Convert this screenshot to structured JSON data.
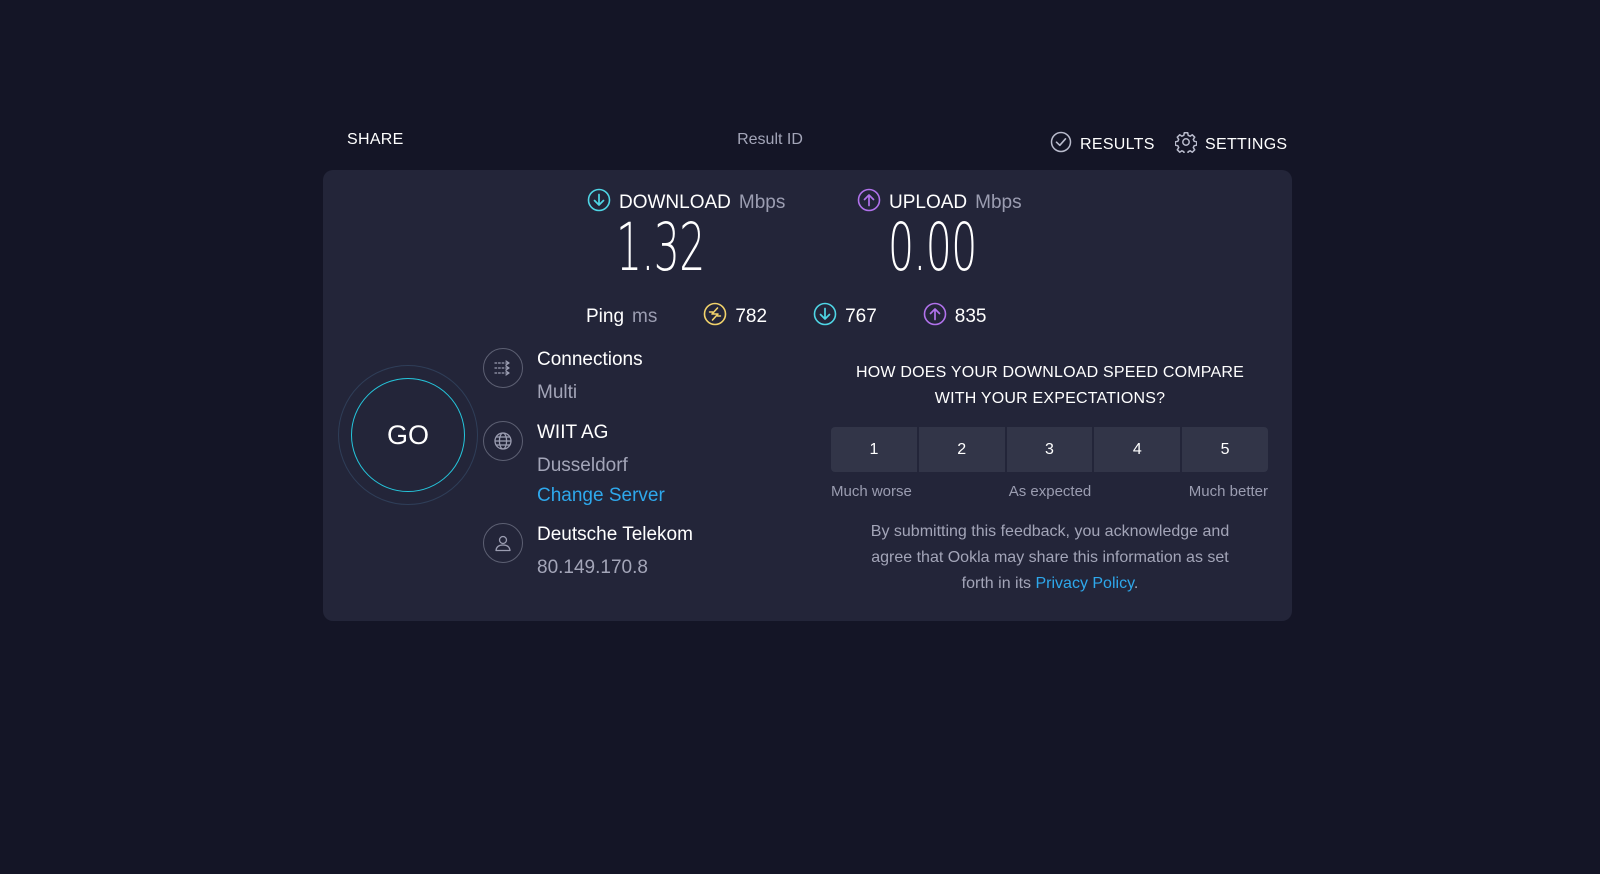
{
  "topbar": {
    "share_label": "SHARE",
    "result_id_label": "Result ID",
    "results_label": "RESULTS",
    "settings_label": "SETTINGS"
  },
  "download": {
    "label": "DOWNLOAD",
    "unit": "Mbps",
    "value": "1.32",
    "color": "#4fd6e6"
  },
  "upload": {
    "label": "UPLOAD",
    "unit": "Mbps",
    "value": "0.00",
    "color": "#b172ec"
  },
  "ping": {
    "label": "Ping",
    "unit": "ms",
    "idle": "782",
    "download": "767",
    "upload": "835",
    "idle_color": "#f2d36b"
  },
  "go_button": {
    "label": "GO"
  },
  "connections": {
    "title": "Connections",
    "value": "Multi"
  },
  "server": {
    "name": "WIIT AG",
    "location": "Dusseldorf",
    "change_label": "Change Server"
  },
  "isp": {
    "name": "Deutsche Telekom",
    "ip": "80.149.170.8"
  },
  "survey": {
    "question_line1": "HOW DOES YOUR DOWNLOAD SPEED COMPARE",
    "question_line2": "WITH YOUR EXPECTATIONS?",
    "options": [
      "1",
      "2",
      "3",
      "4",
      "5"
    ],
    "scale_low": "Much worse",
    "scale_mid": "As expected",
    "scale_high": "Much better",
    "disclaimer_line1": "By submitting this feedback, you acknowledge and",
    "disclaimer_line2": "agree that Ookla may share this information as set",
    "disclaimer_line3_prefix": "forth in its",
    "privacy_link": "Privacy Policy",
    "disclaimer_suffix": "."
  }
}
